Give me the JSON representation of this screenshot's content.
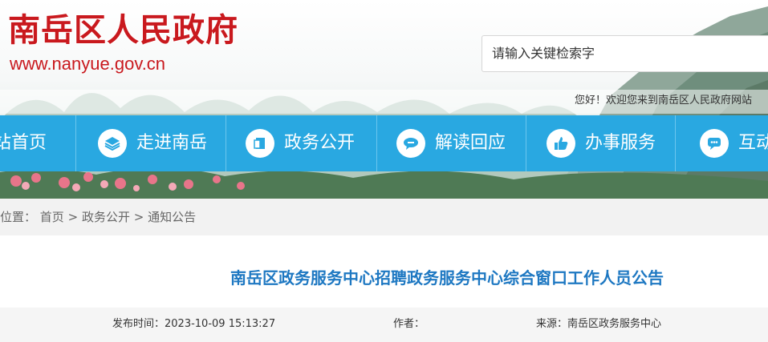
{
  "header": {
    "site_title": "南岳区人民政府",
    "site_url": "www.nanyue.gov.cn",
    "search_placeholder": "请输入关键检索字",
    "welcome": "您好！欢迎您来到南岳区人民政府网站"
  },
  "nav": {
    "items": [
      {
        "label": "网站首页",
        "icon": "home-icon"
      },
      {
        "label": "走进南岳",
        "icon": "layers-icon"
      },
      {
        "label": "政务公开",
        "icon": "document-icon"
      },
      {
        "label": "解读回应",
        "icon": "speech-bubble-icon"
      },
      {
        "label": "办事服务",
        "icon": "thumbs-up-icon"
      },
      {
        "label": "互动交流",
        "icon": "chat-icon"
      }
    ]
  },
  "breadcrumb": {
    "prefix": "当前位置：",
    "items": [
      "首页",
      "政务公开",
      "通知公告"
    ],
    "separator": ">"
  },
  "article": {
    "title": "南岳区政务服务中心招聘政务服务中心综合窗口工作人员公告",
    "publish_label": "发布时间：",
    "publish_time": "2023-10-09 15:13:27",
    "author_label": "作者：",
    "author": "",
    "source_label": "来源：",
    "source": "南岳区政务服务中心"
  },
  "colors": {
    "title_red": "#c9191e",
    "nav_blue": "#29a8e1",
    "article_title_blue": "#1e78c2"
  }
}
